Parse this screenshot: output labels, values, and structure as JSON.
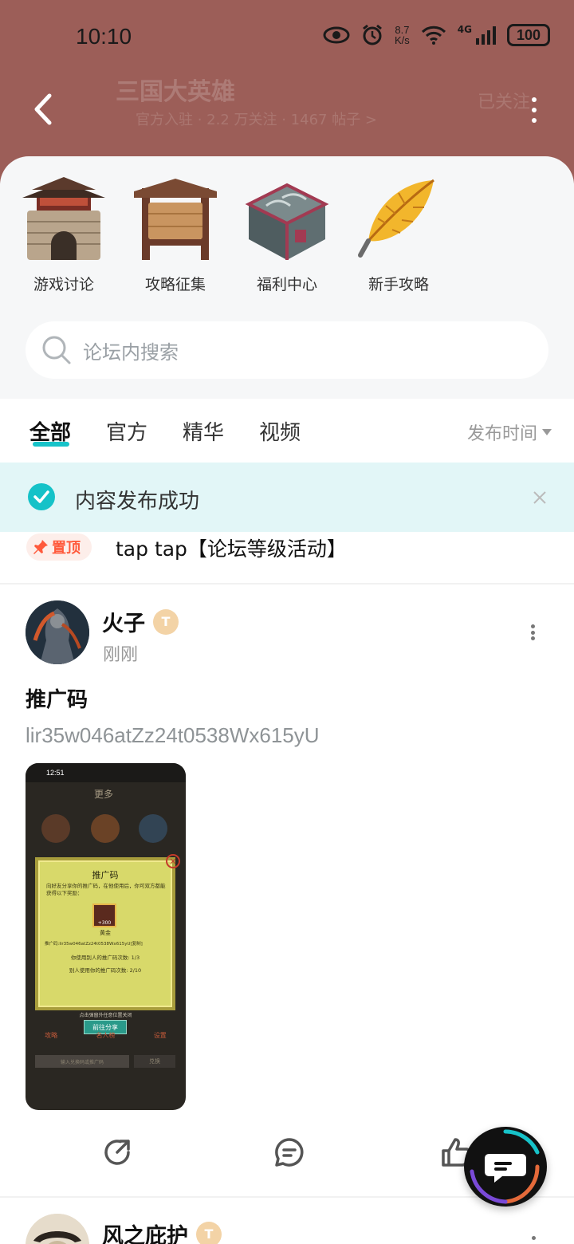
{
  "status_bar": {
    "time": "10:10",
    "speed_top": "8.7",
    "speed_bottom": "K/s",
    "network": "4G",
    "battery": "100"
  },
  "header": {
    "title": "三国大英雄",
    "subtitle": "官方入驻 · 2.2 万关注 · 1467 帖子 >",
    "follow_label": "已关注"
  },
  "categories": [
    {
      "label": "游戏讨论",
      "icon": "fortress-gate-icon"
    },
    {
      "label": "攻略征集",
      "icon": "notice-board-icon"
    },
    {
      "label": "福利中心",
      "icon": "treasure-chest-icon"
    },
    {
      "label": "新手攻略",
      "icon": "golden-leaf-icon"
    }
  ],
  "search": {
    "placeholder": "论坛内搜索"
  },
  "tabs": [
    {
      "label": "全部",
      "active": true
    },
    {
      "label": "官方",
      "active": false
    },
    {
      "label": "精华",
      "active": false
    },
    {
      "label": "视频",
      "active": false
    }
  ],
  "sort": {
    "label": "发布时间"
  },
  "toast": {
    "text": "内容发布成功"
  },
  "pinned": {
    "badge": "置顶",
    "title": "tap tap【论坛等级活动】"
  },
  "post": {
    "author": "火子",
    "level_badge": "T",
    "time": "刚刚",
    "title": "推广码",
    "body": "lir35w046atZz24t0538Wx615yU",
    "image": {
      "status_time": "12:51",
      "top_label": "更多",
      "dialog_title": "推广码",
      "dialog_desc": "向好友分享你的推广码，在他使用后，你可双方都能获得以下奖励：",
      "reward_amount": "+300",
      "reward_name": "黄金",
      "code_line": "推广码:lir35w046atZz24t0538Wx615yU[复制]",
      "used_line": "你使用别人的推广码次数: 1/3",
      "others_line": "别人使用你的推广码次数: 2/10",
      "hint": "点击弹窗外任意位置关闭",
      "share_button": "前往分享",
      "bottom_labels": [
        "攻略",
        "名人榜",
        "设置"
      ],
      "redeem_placeholder": "输入兑换码或推广码",
      "redeem_button": "兑换"
    }
  },
  "next_post": {
    "author": "风之庇护",
    "level_badge": "T"
  },
  "colors": {
    "header_bg": "#9c5e58",
    "accent": "#17c3c9",
    "toast_bg": "#e2f6f7",
    "pin_red": "#ff5a3c"
  }
}
